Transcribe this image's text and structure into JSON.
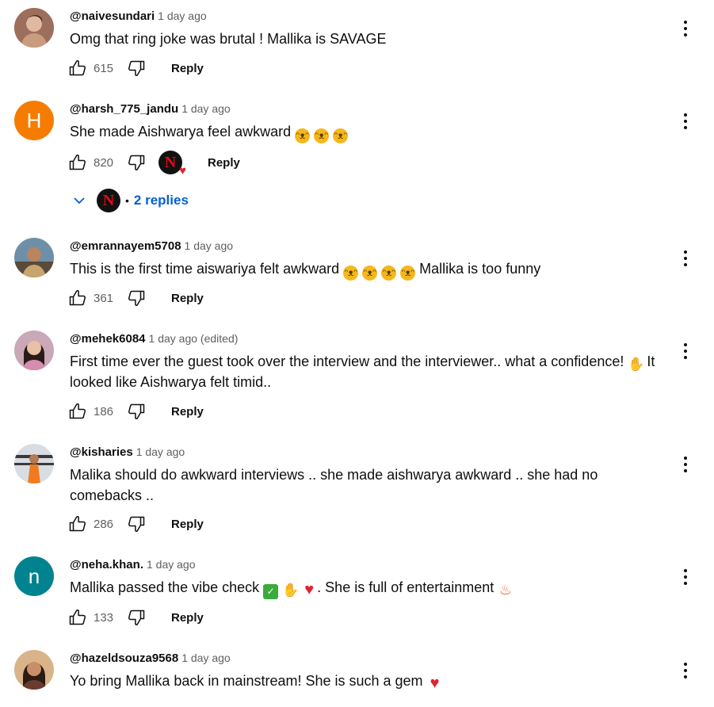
{
  "comments": [
    {
      "handle": "@naivesundari",
      "time": "1 day ago",
      "text": "Omg that ring joke was brutal ! Mallika is SAVAGE",
      "likes": "615",
      "reply_label": "Reply"
    },
    {
      "handle": "@harsh_775_jandu",
      "time": "1 day ago",
      "avatar_letter": "H",
      "avatar_color": "#f57c00",
      "text": "She made Aishwarya feel awkward",
      "likes": "820",
      "reply_label": "Reply",
      "replies_label": "2 replies"
    },
    {
      "handle": "@emrannayem5708",
      "time": "1 day ago",
      "text_a": "This is the first time aiswariya felt awkward",
      "text_b": "Mallika is too funny",
      "likes": "361",
      "reply_label": "Reply"
    },
    {
      "handle": "@mehek6084",
      "time": "1 day ago (edited)",
      "text_a": "First time ever the guest took over the interview and the interviewer.. what a confidence!",
      "text_b": "It looked like Aishwarya felt timid..",
      "likes": "186",
      "reply_label": "Reply"
    },
    {
      "handle": "@kisharies",
      "time": "1 day ago",
      "text": "Malika should do awkward interviews .. she made aishwarya awkward .. she had no comebacks ..",
      "likes": "286",
      "reply_label": "Reply"
    },
    {
      "handle": "@neha.khan.",
      "time": "1 day ago",
      "avatar_letter": "n",
      "avatar_color": "#00838f",
      "text_a": "Mallika passed the vibe check",
      "text_b": ". She is full of entertainment",
      "likes": "133",
      "reply_label": "Reply"
    },
    {
      "handle": "@hazeldsouza9568",
      "time": "1 day ago",
      "text": "Yo bring Mallika back in mainstream! She is such a gem"
    }
  ],
  "icons": {
    "like": "thumb-up-icon",
    "dislike": "thumb-down-icon",
    "more": "more-vert-icon",
    "expand": "chevron-down-icon",
    "creator_badge": "netflix-n-icon"
  },
  "colors": {
    "link": "#065fd4",
    "secondary_text": "#606060",
    "netflix_red": "#e50914"
  }
}
